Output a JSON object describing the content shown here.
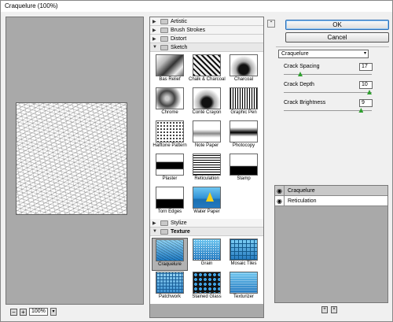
{
  "window": {
    "title": "Craquelure (100%)"
  },
  "preview": {
    "zoom": "100%",
    "zoom_out": "−",
    "zoom_in": "+",
    "zoom_arrow": "▾"
  },
  "gallery": {
    "folders": [
      {
        "label": "Artistic",
        "expanded": false
      },
      {
        "label": "Brush Strokes",
        "expanded": false
      },
      {
        "label": "Distort",
        "expanded": false
      },
      {
        "label": "Sketch",
        "expanded": true
      },
      {
        "label": "Stylize",
        "expanded": false
      },
      {
        "label": "Texture",
        "expanded": true
      }
    ],
    "sketch_filters": [
      "Bas Relief",
      "Chalk & Charcoal",
      "Charcoal",
      "Chrome",
      "Conté Crayon",
      "Graphic Pen",
      "Halftone Pattern",
      "Note Paper",
      "Photocopy",
      "Plaster",
      "Reticulation",
      "Stamp",
      "Torn Edges",
      "Water Paper"
    ],
    "texture_filters": [
      "Craquelure",
      "Grain",
      "Mosaic Tiles",
      "Patchwork",
      "Stained Glass",
      "Texturizer"
    ],
    "selected": "Craquelure"
  },
  "buttons": {
    "ok": "OK",
    "cancel": "Cancel"
  },
  "filter_select": {
    "value": "Craquelure",
    "arrow": "▾"
  },
  "params": [
    {
      "label": "Crack Spacing",
      "value": "17",
      "fraction": 0.17
    },
    {
      "label": "Crack Depth",
      "value": "10",
      "fraction": 1.0
    },
    {
      "label": "Crack Brightness",
      "value": "9",
      "fraction": 0.9
    }
  ],
  "layers": [
    {
      "name": "Craquelure",
      "selected": true
    },
    {
      "name": "Reticulation",
      "selected": false
    }
  ],
  "icons": {
    "collapse": "collapse-icon",
    "eye": "eye-icon",
    "new_layer": "new-layer-icon",
    "delete": "trash-icon"
  }
}
